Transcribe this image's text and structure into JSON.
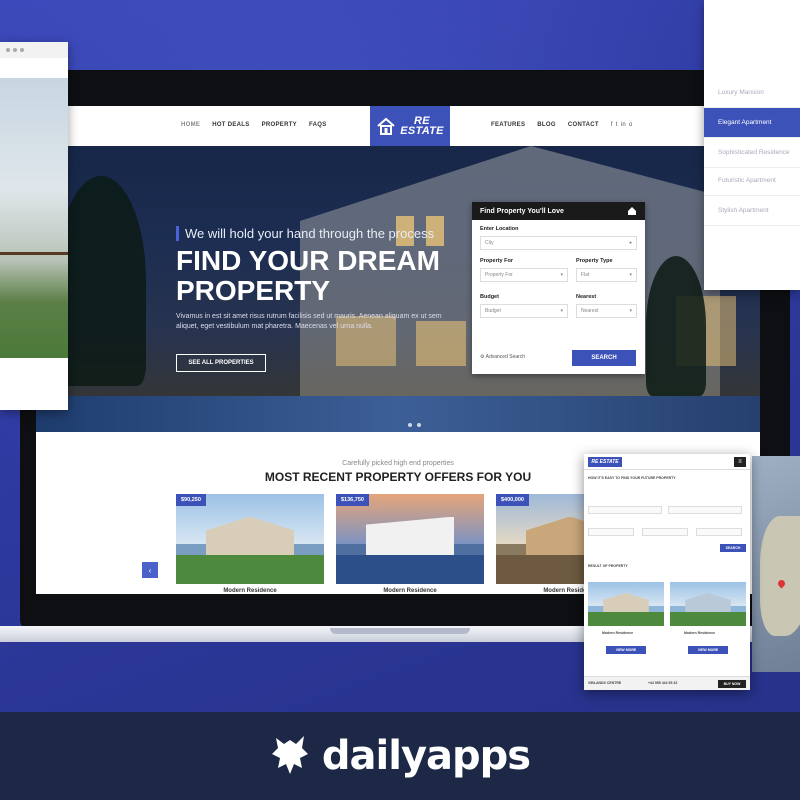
{
  "nav": {
    "left": [
      "HOME",
      "HOT DEALS",
      "PROPERTY",
      "FAQS"
    ],
    "logo_line1": "RE",
    "logo_line2": "ESTATE",
    "right": [
      "FEATURES",
      "BLOG",
      "CONTACT"
    ],
    "social": [
      "f",
      "t",
      "in",
      "o"
    ]
  },
  "hero": {
    "tagline": "We will hold your hand through the process",
    "headline": "FIND YOUR DREAM PROPERTY",
    "description": "Vivamus in est sit amet risus rutrum facilisis sed ut mauris. Aenean aliquam ex ut sem aliquet, eget vestibulum mat pharetra. Maecenas vel urna nulla.",
    "button": "SEE ALL PROPERTIES"
  },
  "search_box": {
    "title": "Find Property You'll Love",
    "location_label": "Enter Location",
    "location_placeholder": "City",
    "property_for_label": "Property For",
    "property_for_value": "Property For",
    "property_type_label": "Property Type",
    "property_type_value": "Flat",
    "budget_label": "Budget",
    "budget_value": "Budget",
    "nearest_label": "Nearest",
    "nearest_value": "Nearest",
    "advanced": "Advanced Search",
    "search_button": "SEARCH"
  },
  "section": {
    "subtitle": "Carefully picked high end properties",
    "title": "MOST RECENT PROPERTY OFFERS FOR YOU"
  },
  "cards": [
    {
      "price": "$90,250",
      "name": "Modern Residence"
    },
    {
      "price": "$136,750",
      "name": "Modern Residence"
    },
    {
      "price": "$400,000",
      "name": "Modern Residence"
    }
  ],
  "right_panel": {
    "items": [
      "Luxury Mansion",
      "Elegant Apartment",
      "Sophisticated Residence",
      "Futuristic Apartment",
      "Stylish Apartment"
    ],
    "active_index": 1
  },
  "phone": {
    "logo": "RE ESTATE",
    "question": "HOW IT'S EASY TO FIND YOUR FUTURE PROPERTY",
    "search": "SEARCH",
    "results_title": "RESULT OF PROPERTY",
    "card_name": "Modern Residence",
    "card_button": "VIEW MORE",
    "footer_left": "VIBLANDS CENTRE",
    "footer_mid": "+44 555 444 55 33",
    "footer_right": "BUY NOW"
  },
  "brand": {
    "name": "dailyapps"
  },
  "colors": {
    "accent": "#3d52b8",
    "background": "#2e3aa0",
    "footer": "#1c2846"
  }
}
